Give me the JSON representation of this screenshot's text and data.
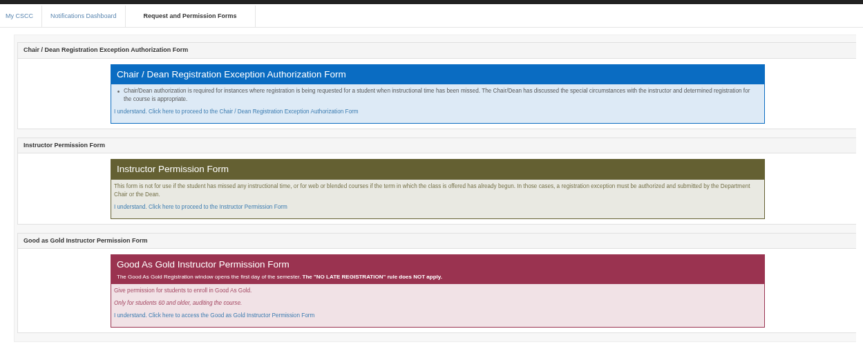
{
  "tabs": [
    {
      "label": "My CSCC",
      "selected": false
    },
    {
      "label": "Notifications Dashboard",
      "selected": false
    },
    {
      "label": "Request and Permission Forms",
      "selected": true
    }
  ],
  "sections": [
    {
      "heading": "Chair / Dean Registration Exception Authorization Form",
      "panel": {
        "title": "Chair / Dean Registration Exception Authorization Form",
        "color": "#0a6cc2",
        "lines": [
          {
            "kind": "bullet",
            "text": "Chair/Dean authorization is required for instances where registration is being requested for a student when instructional time has been missed. The Chair/Dean has discussed the special circumstances with the instructor and determined registration for the course is appropriate."
          },
          {
            "kind": "link",
            "text": "I understand. Click here to proceed to the Chair / Dean Registration Exception Authorization Form"
          }
        ]
      }
    },
    {
      "heading": "Instructor Permission Form",
      "panel": {
        "title": "Instructor Permission Form",
        "color": "#646032",
        "lines": [
          {
            "kind": "text",
            "text": "This form is not for use if the student has missed any instructional time, or for web or blended courses if the term in which the class is offered has already begun. In those cases, a registration exception must be authorized and submitted by the Department Chair or the Dean."
          },
          {
            "kind": "link",
            "text": "I understand. Click here to proceed to the Instructor Permission Form"
          }
        ]
      }
    },
    {
      "heading": "Good as Gold Instructor Permission Form",
      "panel": {
        "title": "Good As Gold Instructor Permission Form",
        "subtitle": "The Good As Gold Registration window opens the first day of the semester. **The \"NO LATE REGISTRATION\" rule does NOT apply.**",
        "color": "#9a3350",
        "lines": [
          {
            "kind": "text",
            "text": "Give permission for students to enroll in Good As Gold."
          },
          {
            "kind": "italic",
            "text": "Only for students 60 and older, auditing the course."
          },
          {
            "kind": "link",
            "text": "I understand. Click here to access the Good as Gold Instructor Permission Form"
          }
        ]
      }
    }
  ]
}
